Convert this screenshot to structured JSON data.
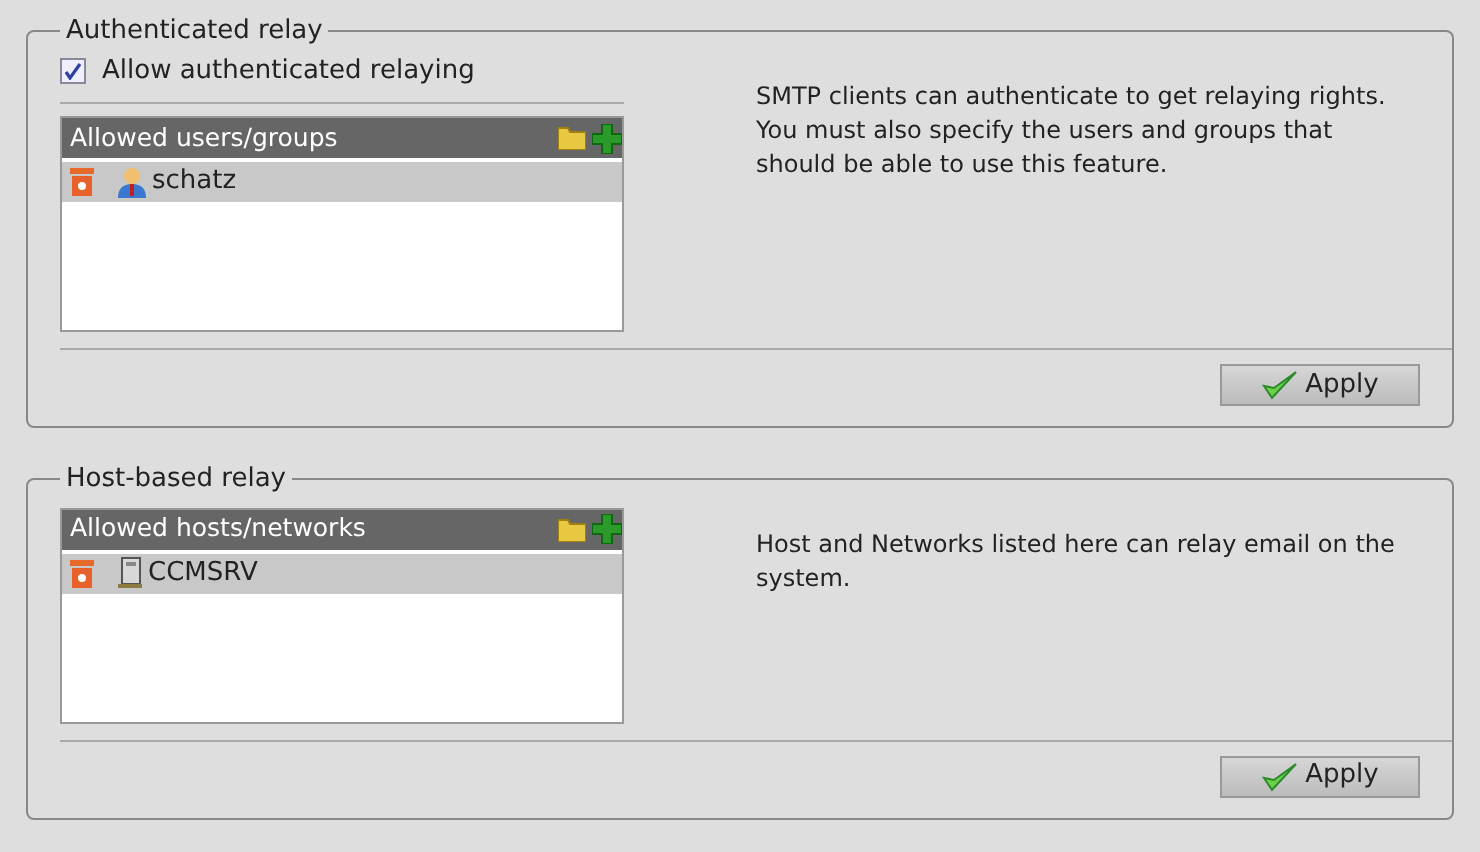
{
  "sections": [
    {
      "title": "Authenticated relay",
      "checkbox": {
        "label": "Allow authenticated relaying",
        "checked": true
      },
      "list": {
        "header": "Allowed users/groups",
        "items": [
          {
            "kind": "user",
            "label": "schatz",
            "selected": true
          }
        ]
      },
      "description": "SMTP clients can authenticate to get relaying rights. You must also specify the users and groups that should be able to use this feature.",
      "button": "Apply"
    },
    {
      "title": "Host-based relay",
      "list": {
        "header": "Allowed hosts/networks",
        "items": [
          {
            "kind": "host",
            "label": "CCMSRV",
            "selected": true
          }
        ]
      },
      "description": "Host and Networks listed here can relay email on the system.",
      "button": "Apply"
    }
  ]
}
